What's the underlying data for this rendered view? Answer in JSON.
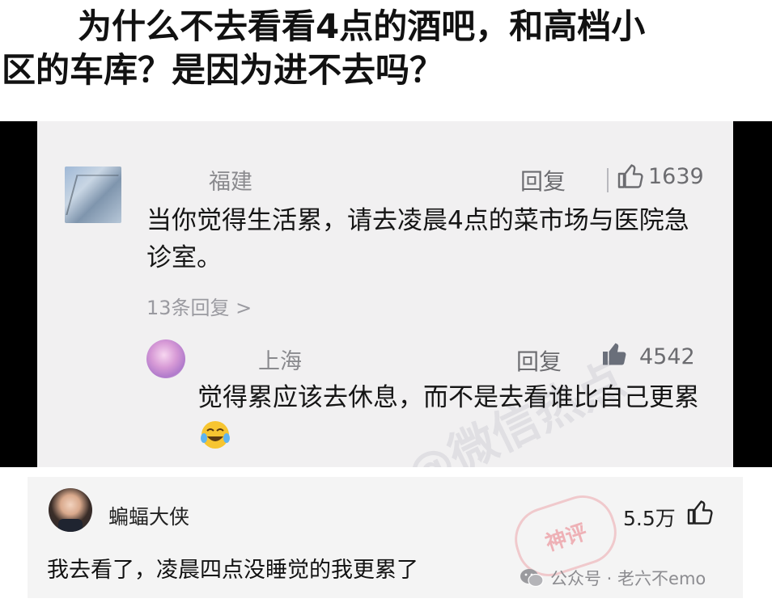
{
  "headline": {
    "line1": "为什么不去看看4点的酒吧，和高档小",
    "line2": "区的车库？是因为进不去吗？"
  },
  "screenshot": {
    "watermark": "@微信热点",
    "comment1": {
      "location": "福建",
      "reply_label": "回复",
      "likes": "1639",
      "text": "当你觉得生活累，请去凌晨4点的菜市场与医院急诊室。",
      "more_replies": "13条回复 >"
    },
    "comment2": {
      "location": "上海",
      "reply_label": "回复",
      "likes": "4542",
      "text": "觉得累应该去休息，而不是去看谁比自己更累"
    }
  },
  "bottom_comment": {
    "username": "蝙蝠大侠",
    "likes": "5.5万",
    "text": "我去看了，凌晨四点没睡觉的我更累了",
    "stamp": "神评"
  },
  "footer": {
    "watermark": "公众号 · 老六不emo"
  },
  "colors": {
    "screenshot_bg": "#f1f0f1",
    "frame": "#000000",
    "like_filled": "#6a6f7a"
  }
}
